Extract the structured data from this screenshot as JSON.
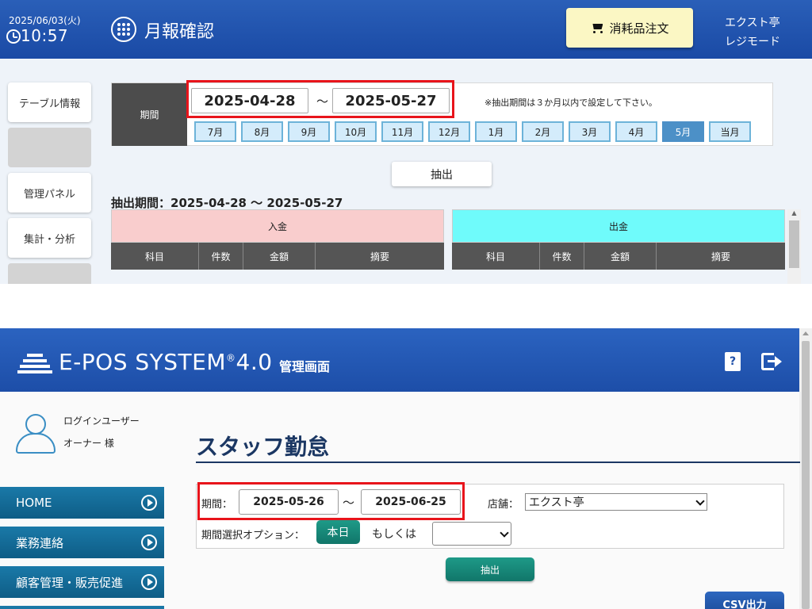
{
  "pos": {
    "date": "2025/06/03(火)",
    "time": "10:57",
    "title": "月報確認",
    "order_button": "消耗品注文",
    "shop": "エクスト亭",
    "mode": "レジモード",
    "sidebar": [
      "テーブル情報",
      "",
      "管理パネル",
      "集計・分析",
      ""
    ],
    "period_label": "期間",
    "date_from": "2025-04-28",
    "date_to": "2025-05-27",
    "tilde": "～",
    "note": "※抽出期間は３か月以内で設定して下さい。",
    "months": [
      "7月",
      "8月",
      "9月",
      "10月",
      "11月",
      "12月",
      "1月",
      "2月",
      "3月",
      "4月",
      "5月",
      "当月"
    ],
    "active_month": "5月",
    "extract_button": "抽出",
    "extract_period": "抽出期間：2025-04-28 ～ 2025-05-27",
    "income_title": "入金",
    "outgo_title": "出金",
    "columns": [
      "科目",
      "件数",
      "金額",
      "摘要"
    ],
    "colors": {
      "income": "#f9cdcd",
      "outgo": "#6ffbfb",
      "active_month": "#4c90c7"
    }
  },
  "epos": {
    "logo": "E-POS SYSTEM",
    "registered": "®",
    "version": "4.0",
    "admin_label": "管理画面",
    "manual_icon_glyph": "?",
    "login_user_label": "ログインユーザー",
    "user_name": "オーナー 様",
    "nav": [
      "HOME",
      "業務連絡",
      "顧客管理・販売促進"
    ],
    "page_title": "スタッフ勤怠",
    "period_label": "期間：",
    "date_from": "2025-05-26",
    "date_to": "2025-06-25",
    "tilde": "～",
    "store_label": "店舗：",
    "store_value": "エクスト亭",
    "period_option_label": "期間選択オプション：",
    "today_button": "本日",
    "or_label": "もしくは",
    "option_value": "",
    "extract_button": "抽出",
    "csv_button": "CSV出力",
    "colors": {
      "header": "#1d4ea8",
      "nav": "#0e5d86",
      "accent": "#11766a",
      "title": "#1b3763"
    }
  }
}
